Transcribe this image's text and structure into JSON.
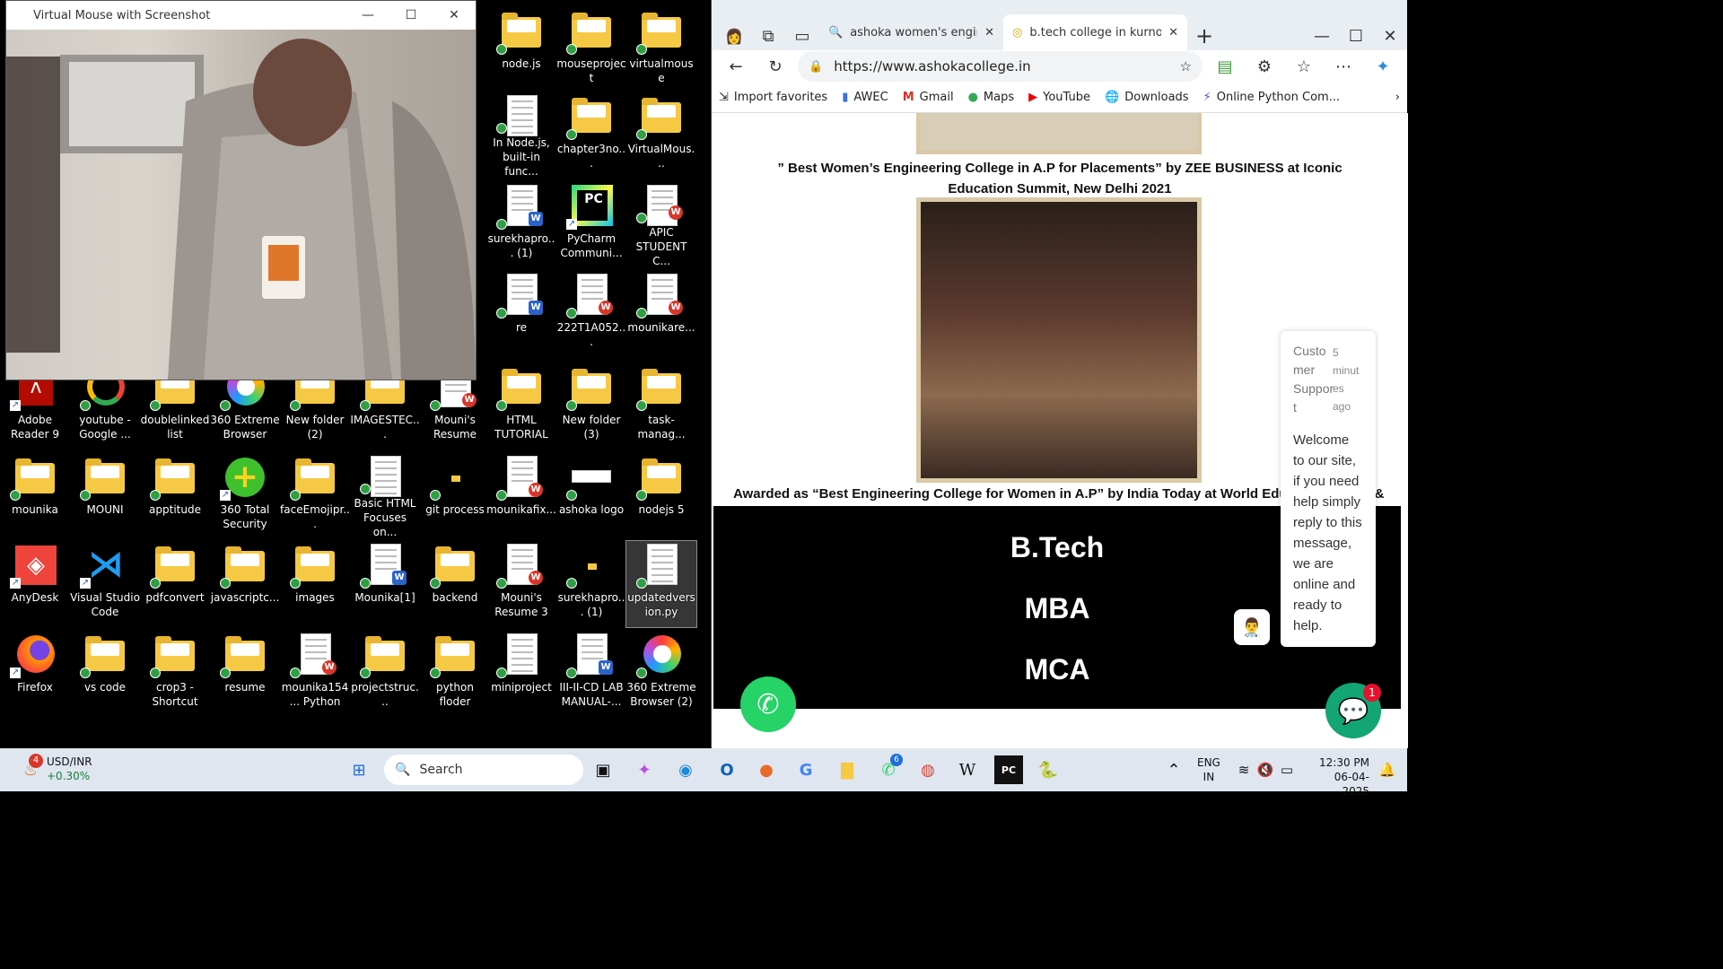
{
  "camera_window": {
    "title": "Virtual Mouse with Screenshot",
    "controls": [
      "—",
      "☐",
      "✕"
    ]
  },
  "desktop_icons": [
    {
      "label": "node.js",
      "type": "folder"
    },
    {
      "label": "mouseproject",
      "type": "folder"
    },
    {
      "label": "virtualmouse",
      "type": "folder"
    },
    {
      "label": "In Node.js, built-in func...",
      "type": "doc"
    },
    {
      "label": "chapter3no...",
      "type": "folder"
    },
    {
      "label": "VirtualMous...",
      "type": "folder"
    },
    {
      "label": "surekhapro... (1)",
      "type": "word"
    },
    {
      "label": "PyCharm Communi...",
      "type": "pycharm"
    },
    {
      "label": "APIC STUDENT C...",
      "type": "wps"
    },
    {
      "label": "re",
      "type": "word"
    },
    {
      "label": "222T1A052...",
      "type": "wps"
    },
    {
      "label": "mounikare...",
      "type": "wps"
    },
    {
      "label": "Adobe Reader 9",
      "type": "adobe"
    },
    {
      "label": "youtube - Google ...",
      "type": "google"
    },
    {
      "label": "doublelinked list",
      "type": "folder"
    },
    {
      "label": "360 Extreme Browser",
      "type": "360"
    },
    {
      "label": "New folder (2)",
      "type": "folder"
    },
    {
      "label": "IMAGESTEC...",
      "type": "folder"
    },
    {
      "label": "Mouni's Resume",
      "type": "wps"
    },
    {
      "label": "HTML TUTORIAL",
      "type": "folder"
    },
    {
      "label": "New folder (3)",
      "type": "folder"
    },
    {
      "label": "task-manag...",
      "type": "folder"
    },
    {
      "label": "mounika",
      "type": "folder"
    },
    {
      "label": "MOUNI",
      "type": "folder"
    },
    {
      "label": "apptitude",
      "type": "folder"
    },
    {
      "label": "360 Total Security",
      "type": "360ts"
    },
    {
      "label": "faceEmojipr...",
      "type": "folder"
    },
    {
      "label": "Basic HTML Focuses on...",
      "type": "doc"
    },
    {
      "label": "git process",
      "type": "small"
    },
    {
      "label": "mounikafix...",
      "type": "wps"
    },
    {
      "label": "ashoka logo",
      "type": "img"
    },
    {
      "label": "nodejs 5",
      "type": "folder"
    },
    {
      "label": "AnyDesk",
      "type": "anydesk"
    },
    {
      "label": "Visual Studio Code",
      "type": "vscode"
    },
    {
      "label": "pdfconvert",
      "type": "folder"
    },
    {
      "label": "javascriptc...",
      "type": "folder"
    },
    {
      "label": "images",
      "type": "folder"
    },
    {
      "label": "Mounika[1]",
      "type": "word"
    },
    {
      "label": "backend",
      "type": "folder"
    },
    {
      "label": "Mouni's Resume 3",
      "type": "wps"
    },
    {
      "label": "surekhapro... (1)",
      "type": "small"
    },
    {
      "label": "updatedversion.py",
      "type": "doc"
    },
    {
      "label": "Firefox",
      "type": "firefox"
    },
    {
      "label": "vs code",
      "type": "folder"
    },
    {
      "label": "crop3 - Shortcut",
      "type": "folder"
    },
    {
      "label": "resume",
      "type": "folder"
    },
    {
      "label": "mounika154... Python",
      "type": "wps"
    },
    {
      "label": "projectstruc...",
      "type": "folder"
    },
    {
      "label": "python floder",
      "type": "folder"
    },
    {
      "label": "miniproject",
      "type": "doc"
    },
    {
      "label": "III-II-CD LAB MANUAL-...",
      "type": "word"
    },
    {
      "label": "360 Extreme Browser (2)",
      "type": "360"
    }
  ],
  "browser": {
    "tabs": [
      {
        "title": "ashoka women's engineering",
        "active": false
      },
      {
        "title": "b.tech college in kurnool| re",
        "active": true
      }
    ],
    "new_tab": "+",
    "url": "https://www.ashokacollege.in",
    "favorites": [
      "Import favorites",
      "AWEC",
      "Gmail",
      "Maps",
      "YouTube",
      "Downloads",
      "Online Python Com..."
    ],
    "page": {
      "caption1": "” Best Women’s Engineering College in A.P for Placements” by ZEE BUSINESS at Iconic Education Summit, New Delhi 2021",
      "caption2": "Awarded as “Best Engineering College for Women in A.P” by India Today at World Educ",
      "caption2_tail": "&",
      "programs": [
        "B.Tech",
        "MBA",
        "MCA"
      ]
    },
    "chat": {
      "who": "Custo mer Suppor t",
      "when": "5 minut es ago",
      "message": "Welcome to our site, if you need help simply reply to this message, we are online and ready to help.",
      "unread": "1"
    }
  },
  "taskbar": {
    "ticker_symbol": "USD/INR",
    "ticker_change": "+0.30%",
    "ticker_badge": "4",
    "search_placeholder": "Search",
    "whatsapp_badge": "6",
    "lang1": "ENG",
    "lang2": "IN",
    "time": "12:30 PM",
    "date": "06-04-2025"
  }
}
